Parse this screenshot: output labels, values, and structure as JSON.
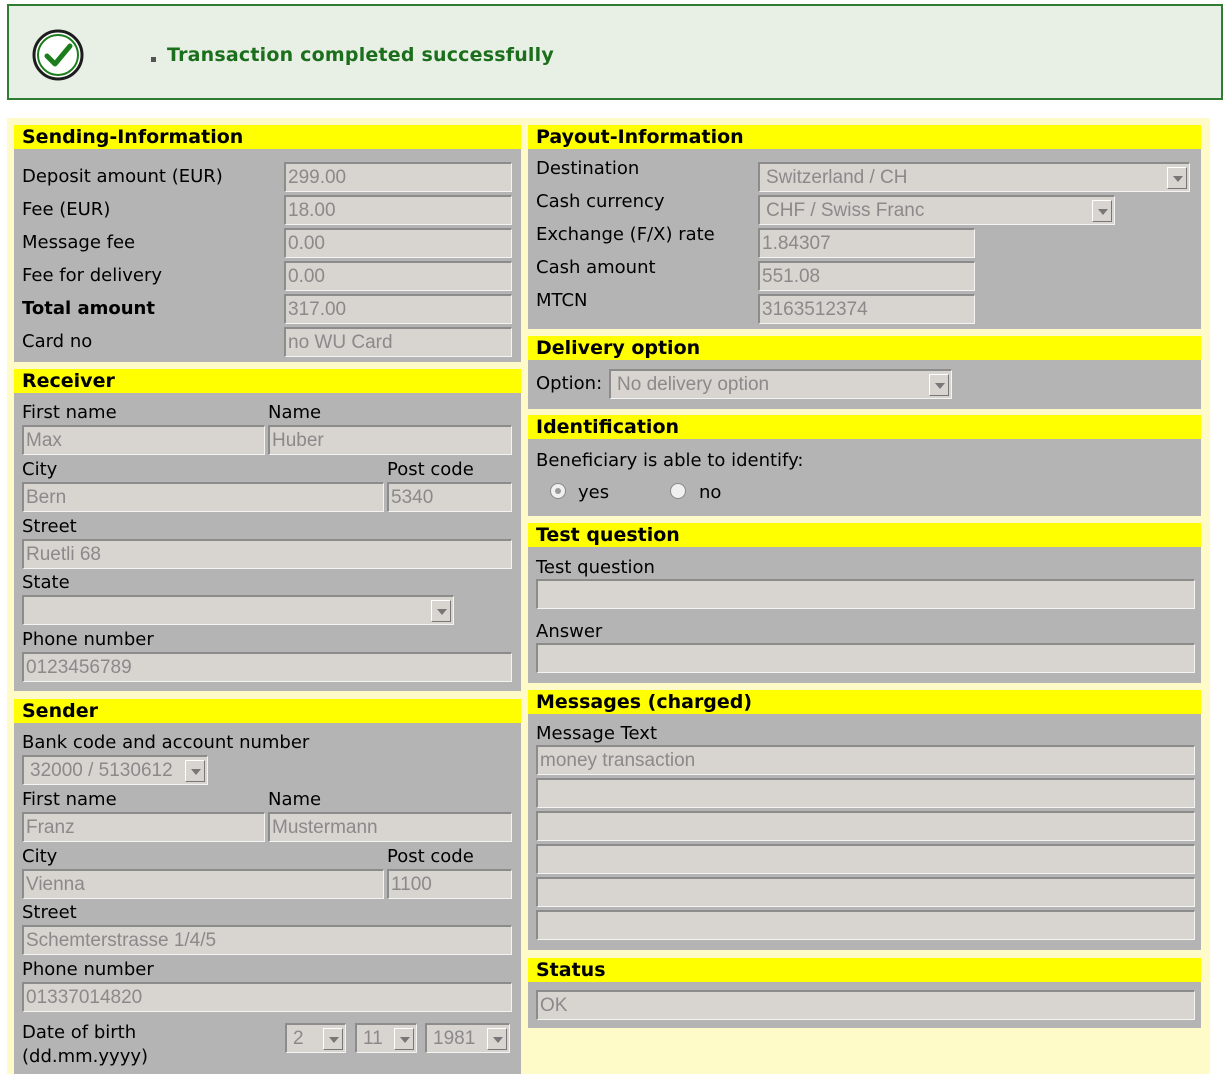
{
  "banner": {
    "message": "Transaction completed successfully"
  },
  "sending": {
    "title": "Sending-Information",
    "deposit_label": "Deposit amount (EUR)",
    "deposit_value": "299.00",
    "fee_label": "Fee (EUR)",
    "fee_value": "18.00",
    "message_fee_label": "Message fee",
    "message_fee_value": "0.00",
    "delivery_fee_label": "Fee for delivery",
    "delivery_fee_value": "0.00",
    "total_label": "Total amount",
    "total_value": "317.00",
    "card_label": "Card no",
    "card_value": "no WU Card"
  },
  "receiver": {
    "title": "Receiver",
    "first_name_label": "First name",
    "first_name": "Max",
    "name_label": "Name",
    "name": "Huber",
    "city_label": "City",
    "city": "Bern",
    "post_code_label": "Post code",
    "post_code": "5340",
    "street_label": "Street",
    "street": "Ruetli 68",
    "state_label": "State",
    "state": "",
    "phone_label": "Phone number",
    "phone": "0123456789"
  },
  "sender": {
    "title": "Sender",
    "bank_label": "Bank code and account number",
    "bank": "32000 / 5130612",
    "first_name_label": "First name",
    "first_name": "Franz",
    "name_label": "Name",
    "name": "Mustermann",
    "city_label": "City",
    "city": "Vienna",
    "post_code_label": "Post code",
    "post_code": "1100",
    "street_label": "Street",
    "street": "Schemterstrasse 1/4/5",
    "phone_label": "Phone number",
    "phone": "01337014820",
    "dob_label_1": "Date of birth",
    "dob_label_2": "(dd.mm.yyyy)",
    "dob_day": "2",
    "dob_month": "11",
    "dob_year": "1981"
  },
  "payout": {
    "title": "Payout-Information",
    "destination_label": "Destination",
    "destination": "Switzerland / CH",
    "currency_label": "Cash currency",
    "currency": "CHF / Swiss Franc",
    "rate_label": "Exchange (F/X) rate",
    "rate": "1.84307",
    "cash_label": "Cash amount",
    "cash": "551.08",
    "mtcn_label": "MTCN",
    "mtcn": "3163512374"
  },
  "delivery": {
    "title": "Delivery option",
    "option_label": "Option:",
    "option": "No delivery option"
  },
  "identification": {
    "title": "Identification",
    "question": "Beneficiary is able to identify:",
    "yes_label": "yes",
    "no_label": "no"
  },
  "test": {
    "title": "Test question",
    "question_label": "Test question",
    "question": "",
    "answer_label": "Answer",
    "answer": ""
  },
  "messages": {
    "title": "Messages (charged)",
    "text_label": "Message Text",
    "lines": [
      "money transaction",
      "",
      "",
      "",
      "",
      ""
    ]
  },
  "status": {
    "title": "Status",
    "value": "OK"
  },
  "colors": {
    "section_header": "#ffff00",
    "panel": "#b4b4b4",
    "background": "#fffbc8",
    "success": "#1b6e1b"
  }
}
